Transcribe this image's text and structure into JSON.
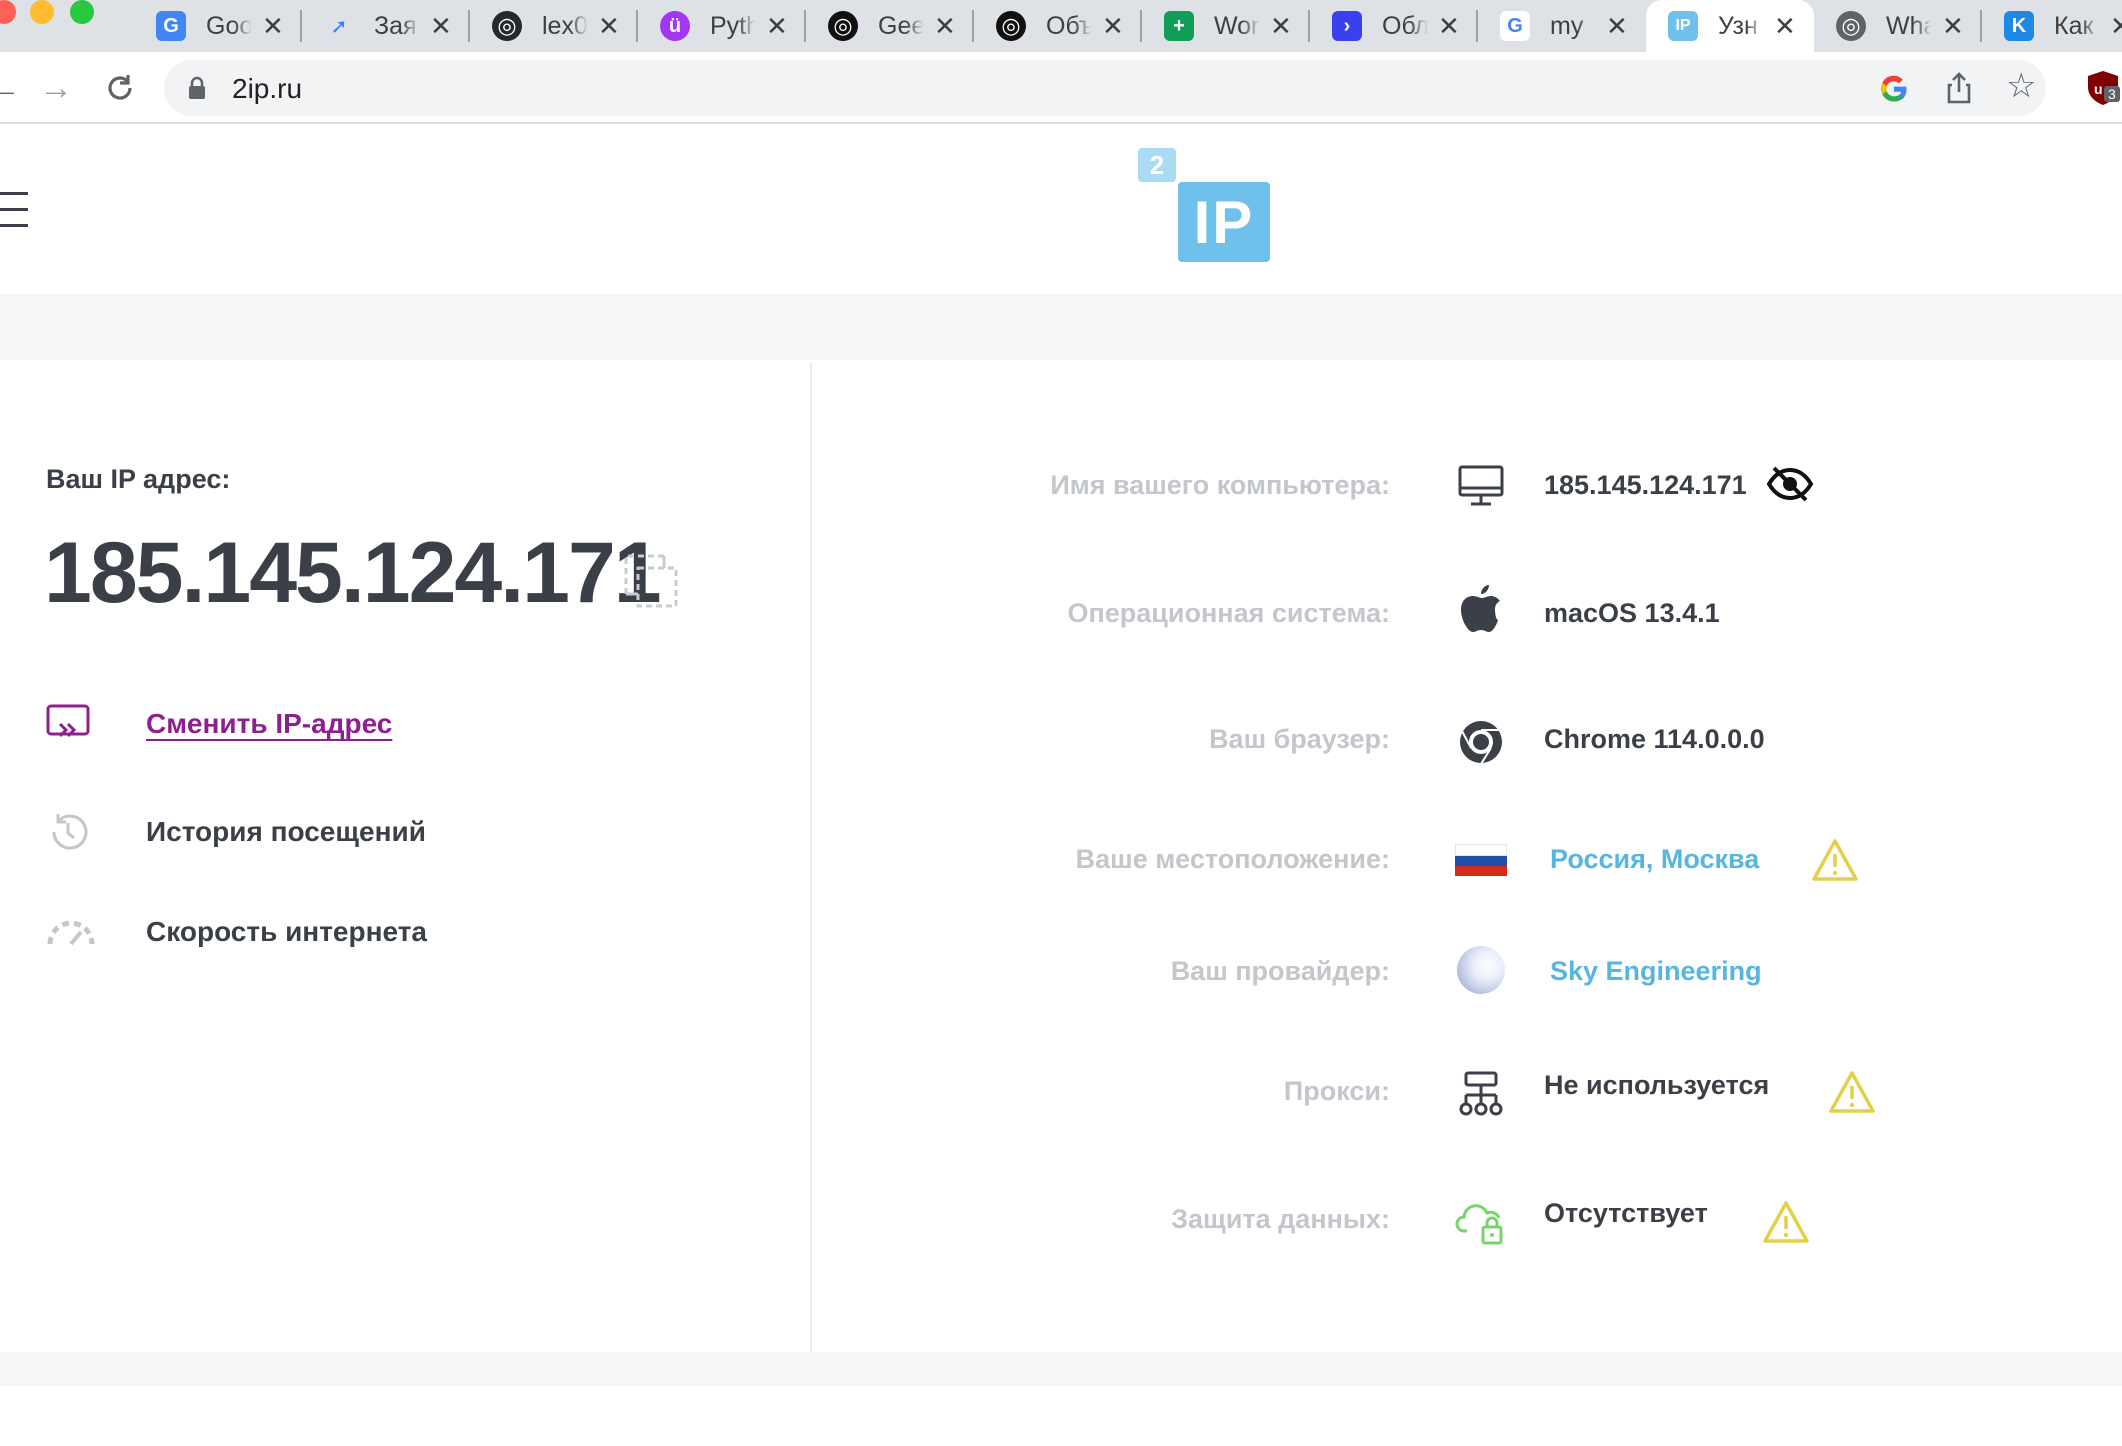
{
  "tabs": [
    {
      "title": "Goo",
      "favicon": "google-translate-icon",
      "color": "#4285f4"
    },
    {
      "title": "Зая",
      "favicon": "jira-icon",
      "color": "#2684ff"
    },
    {
      "title": "lex0",
      "favicon": "github-icon",
      "color": "#24292e"
    },
    {
      "title": "Pyth",
      "favicon": "udemy-icon",
      "color": "#a435f0"
    },
    {
      "title": "Gee",
      "favicon": "openai-icon",
      "color": "#111111"
    },
    {
      "title": "Объ",
      "favicon": "openai-icon",
      "color": "#111111"
    },
    {
      "title": "Wor",
      "favicon": "sheets-icon",
      "color": "#0f9d58"
    },
    {
      "title": "Обл",
      "favicon": "arrow-app-icon",
      "color": "#3a3ff0"
    },
    {
      "title": "my",
      "favicon": "google-icon",
      "color": "#ffffff"
    },
    {
      "title": "Узн",
      "favicon": "2ip-icon",
      "color": "#6fc0ea"
    },
    {
      "title": "Wha",
      "favicon": "globe-icon",
      "color": "#5f6368"
    },
    {
      "title": "Как",
      "favicon": "k-icon",
      "color": "#1e88e5"
    }
  ],
  "address_bar": {
    "url": "2ip.ru"
  },
  "extension_badge": "3",
  "logo": {
    "small": "2",
    "main": "IP"
  },
  "ip_panel": {
    "title": "Ваш IP адрес:",
    "ip": "185.145.124.171",
    "links": {
      "change_ip": "Сменить IP-адрес",
      "history": "История посещений",
      "speed": "Скорость интернета"
    }
  },
  "info": {
    "computer_name": {
      "label": "Имя вашего компьютера:",
      "value": "185.145.124.171"
    },
    "os": {
      "label": "Операционная система:",
      "value": "macOS 13.4.1"
    },
    "browser": {
      "label": "Ваш браузер:",
      "value": "Chrome 114.0.0.0"
    },
    "location": {
      "label": "Ваше местоположение:",
      "value": "Россия, Москва"
    },
    "provider": {
      "label": "Ваш провайдер:",
      "value": "Sky Engineering"
    },
    "proxy": {
      "label": "Прокси:",
      "value": "Не используется"
    },
    "data_protection": {
      "label": "Защита данных:",
      "value": "Отсутствует"
    }
  },
  "colors": {
    "accent_purple": "#8e1f8e",
    "link_blue": "#56b6e0",
    "warning_yellow": "#e2cf4a",
    "protection_green": "#79d36b",
    "logo_blue": "#6fc0ea"
  }
}
